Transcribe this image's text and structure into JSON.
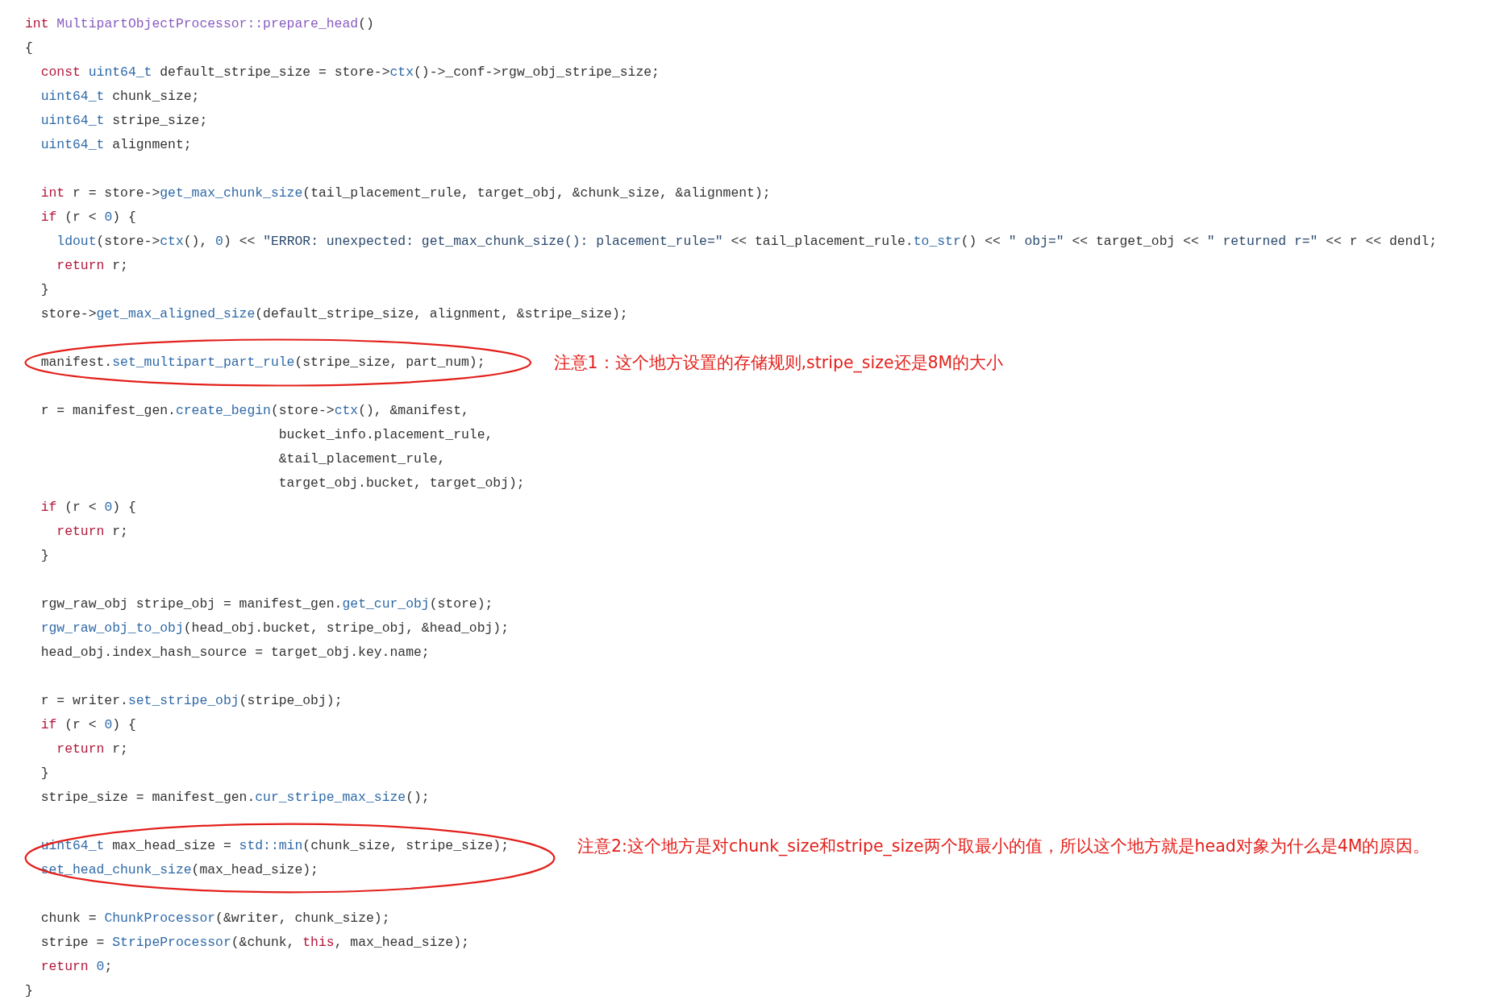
{
  "code_blocks": [
    {
      "kind": "plain",
      "lines": [
        {
          "kind": "code",
          "tokens": [
            {
              "kind": "kw",
              "text": "int "
            },
            {
              "kind": "cls",
              "text": "MultipartObjectProcessor::prepare_head"
            },
            {
              "kind": "p",
              "text": "()"
            }
          ]
        },
        {
          "kind": "code",
          "tokens": [
            {
              "kind": "p",
              "text": "{"
            }
          ]
        },
        {
          "kind": "code",
          "tokens": [
            {
              "kind": "kw",
              "text": "  const "
            },
            {
              "kind": "fn",
              "text": "uint64_t"
            },
            {
              "kind": "p",
              "text": " default_stripe_size = store->"
            },
            {
              "kind": "fn",
              "text": "ctx"
            },
            {
              "kind": "p",
              "text": "()->_conf->rgw_obj_stripe_size;"
            }
          ]
        },
        {
          "kind": "code",
          "tokens": [
            {
              "kind": "fn",
              "text": "  uint64_t"
            },
            {
              "kind": "p",
              "text": " chunk_size;"
            }
          ]
        },
        {
          "kind": "code",
          "tokens": [
            {
              "kind": "fn",
              "text": "  uint64_t"
            },
            {
              "kind": "p",
              "text": " stripe_size;"
            }
          ]
        },
        {
          "kind": "code",
          "tokens": [
            {
              "kind": "fn",
              "text": "  uint64_t"
            },
            {
              "kind": "p",
              "text": " alignment;"
            }
          ]
        },
        {
          "kind": "blank"
        },
        {
          "kind": "code",
          "tokens": [
            {
              "kind": "kw",
              "text": "  int"
            },
            {
              "kind": "p",
              "text": " r = store->"
            },
            {
              "kind": "fn",
              "text": "get_max_chunk_size"
            },
            {
              "kind": "p",
              "text": "(tail_placement_rule, target_obj, &chunk_size, &alignment);"
            }
          ]
        },
        {
          "kind": "code",
          "tokens": [
            {
              "kind": "kw",
              "text": "  if"
            },
            {
              "kind": "p",
              "text": " (r < "
            },
            {
              "kind": "num",
              "text": "0"
            },
            {
              "kind": "p",
              "text": ") {"
            }
          ]
        },
        {
          "kind": "code",
          "tokens": [
            {
              "kind": "fn",
              "text": "    ldout"
            },
            {
              "kind": "p",
              "text": "(store->"
            },
            {
              "kind": "fn",
              "text": "ctx"
            },
            {
              "kind": "p",
              "text": "(), "
            },
            {
              "kind": "num",
              "text": "0"
            },
            {
              "kind": "p",
              "text": ") << "
            },
            {
              "kind": "str",
              "text": "\"ERROR: unexpected: get_max_chunk_size(): placement_rule=\""
            },
            {
              "kind": "p",
              "text": " << tail_placement_rule."
            },
            {
              "kind": "fn",
              "text": "to_str"
            },
            {
              "kind": "p",
              "text": "() << "
            },
            {
              "kind": "str",
              "text": "\" obj=\""
            },
            {
              "kind": "p",
              "text": " << target_obj << "
            },
            {
              "kind": "str",
              "text": "\" returned r=\""
            },
            {
              "kind": "p",
              "text": " << r << dendl;"
            }
          ]
        },
        {
          "kind": "code",
          "tokens": [
            {
              "kind": "kw",
              "text": "    return"
            },
            {
              "kind": "p",
              "text": " r;"
            }
          ]
        },
        {
          "kind": "code",
          "tokens": [
            {
              "kind": "p",
              "text": "  }"
            }
          ]
        },
        {
          "kind": "code",
          "tokens": [
            {
              "kind": "p",
              "text": "  store->"
            },
            {
              "kind": "fn",
              "text": "get_max_aligned_size"
            },
            {
              "kind": "p",
              "text": "(default_stripe_size, alignment, &stripe_size);"
            }
          ]
        },
        {
          "kind": "blank"
        }
      ]
    },
    {
      "kind": "annotated",
      "note": "注意1：这个地方设置的存储规则,stripe_size还是8M的大小",
      "lines": [
        {
          "kind": "code",
          "tokens": [
            {
              "kind": "p",
              "text": "  manifest."
            },
            {
              "kind": "fn",
              "text": "set_multipart_part_rule"
            },
            {
              "kind": "p",
              "text": "(stripe_size, part_num);"
            }
          ]
        }
      ]
    },
    {
      "kind": "plain",
      "lines": [
        {
          "kind": "blank"
        },
        {
          "kind": "code",
          "tokens": [
            {
              "kind": "p",
              "text": "  r = manifest_gen."
            },
            {
              "kind": "fn",
              "text": "create_begin"
            },
            {
              "kind": "p",
              "text": "(store->"
            },
            {
              "kind": "fn",
              "text": "ctx"
            },
            {
              "kind": "p",
              "text": "(), &manifest,"
            }
          ]
        },
        {
          "kind": "code",
          "tokens": [
            {
              "kind": "p",
              "text": "                                bucket_info.placement_rule,"
            }
          ]
        },
        {
          "kind": "code",
          "tokens": [
            {
              "kind": "p",
              "text": "                                &tail_placement_rule,"
            }
          ]
        },
        {
          "kind": "code",
          "tokens": [
            {
              "kind": "p",
              "text": "                                target_obj.bucket, target_obj);"
            }
          ]
        },
        {
          "kind": "code",
          "tokens": [
            {
              "kind": "kw",
              "text": "  if"
            },
            {
              "kind": "p",
              "text": " (r < "
            },
            {
              "kind": "num",
              "text": "0"
            },
            {
              "kind": "p",
              "text": ") {"
            }
          ]
        },
        {
          "kind": "code",
          "tokens": [
            {
              "kind": "kw",
              "text": "    return"
            },
            {
              "kind": "p",
              "text": " r;"
            }
          ]
        },
        {
          "kind": "code",
          "tokens": [
            {
              "kind": "p",
              "text": "  }"
            }
          ]
        },
        {
          "kind": "blank"
        },
        {
          "kind": "code",
          "tokens": [
            {
              "kind": "p",
              "text": "  rgw_raw_obj stripe_obj = manifest_gen."
            },
            {
              "kind": "fn",
              "text": "get_cur_obj"
            },
            {
              "kind": "p",
              "text": "(store);"
            }
          ]
        },
        {
          "kind": "code",
          "tokens": [
            {
              "kind": "fn",
              "text": "  rgw_raw_obj_to_obj"
            },
            {
              "kind": "p",
              "text": "(head_obj.bucket, stripe_obj, &head_obj);"
            }
          ]
        },
        {
          "kind": "code",
          "tokens": [
            {
              "kind": "p",
              "text": "  head_obj.index_hash_source = target_obj.key.name;"
            }
          ]
        },
        {
          "kind": "blank"
        },
        {
          "kind": "code",
          "tokens": [
            {
              "kind": "p",
              "text": "  r = writer."
            },
            {
              "kind": "fn",
              "text": "set_stripe_obj"
            },
            {
              "kind": "p",
              "text": "(stripe_obj);"
            }
          ]
        },
        {
          "kind": "code",
          "tokens": [
            {
              "kind": "kw",
              "text": "  if"
            },
            {
              "kind": "p",
              "text": " (r < "
            },
            {
              "kind": "num",
              "text": "0"
            },
            {
              "kind": "p",
              "text": ") {"
            }
          ]
        },
        {
          "kind": "code",
          "tokens": [
            {
              "kind": "kw",
              "text": "    return"
            },
            {
              "kind": "p",
              "text": " r;"
            }
          ]
        },
        {
          "kind": "code",
          "tokens": [
            {
              "kind": "p",
              "text": "  }"
            }
          ]
        },
        {
          "kind": "code",
          "tokens": [
            {
              "kind": "p",
              "text": "  stripe_size = manifest_gen."
            },
            {
              "kind": "fn",
              "text": "cur_stripe_max_size"
            },
            {
              "kind": "p",
              "text": "();"
            }
          ]
        },
        {
          "kind": "blank"
        }
      ]
    },
    {
      "kind": "annotated",
      "note": "注意2:这个地方是对chunk_size和stripe_size两个取最小的值，所以这个地方就是head对象为什么是4M的原因。",
      "lines": [
        {
          "kind": "code",
          "tokens": [
            {
              "kind": "fn",
              "text": "  uint64_t"
            },
            {
              "kind": "p",
              "text": " max_head_size = "
            },
            {
              "kind": "fn",
              "text": "std::min"
            },
            {
              "kind": "p",
              "text": "(chunk_size, stripe_size);"
            }
          ]
        },
        {
          "kind": "code",
          "tokens": [
            {
              "kind": "fn",
              "text": "  set_head_chunk_size"
            },
            {
              "kind": "p",
              "text": "(max_head_size);"
            }
          ]
        }
      ]
    },
    {
      "kind": "plain",
      "lines": [
        {
          "kind": "blank"
        },
        {
          "kind": "code",
          "tokens": [
            {
              "kind": "p",
              "text": "  chunk = "
            },
            {
              "kind": "fn",
              "text": "ChunkProcessor"
            },
            {
              "kind": "p",
              "text": "(&writer, chunk_size);"
            }
          ]
        },
        {
          "kind": "code",
          "tokens": [
            {
              "kind": "p",
              "text": "  stripe = "
            },
            {
              "kind": "fn",
              "text": "StripeProcessor"
            },
            {
              "kind": "p",
              "text": "(&chunk, "
            },
            {
              "kind": "kw",
              "text": "this"
            },
            {
              "kind": "p",
              "text": ", max_head_size);"
            }
          ]
        },
        {
          "kind": "code",
          "tokens": [
            {
              "kind": "kw",
              "text": "  return "
            },
            {
              "kind": "num",
              "text": "0"
            },
            {
              "kind": "p",
              "text": ";"
            }
          ]
        },
        {
          "kind": "code",
          "tokens": [
            {
              "kind": "p",
              "text": "}"
            }
          ]
        }
      ]
    }
  ]
}
